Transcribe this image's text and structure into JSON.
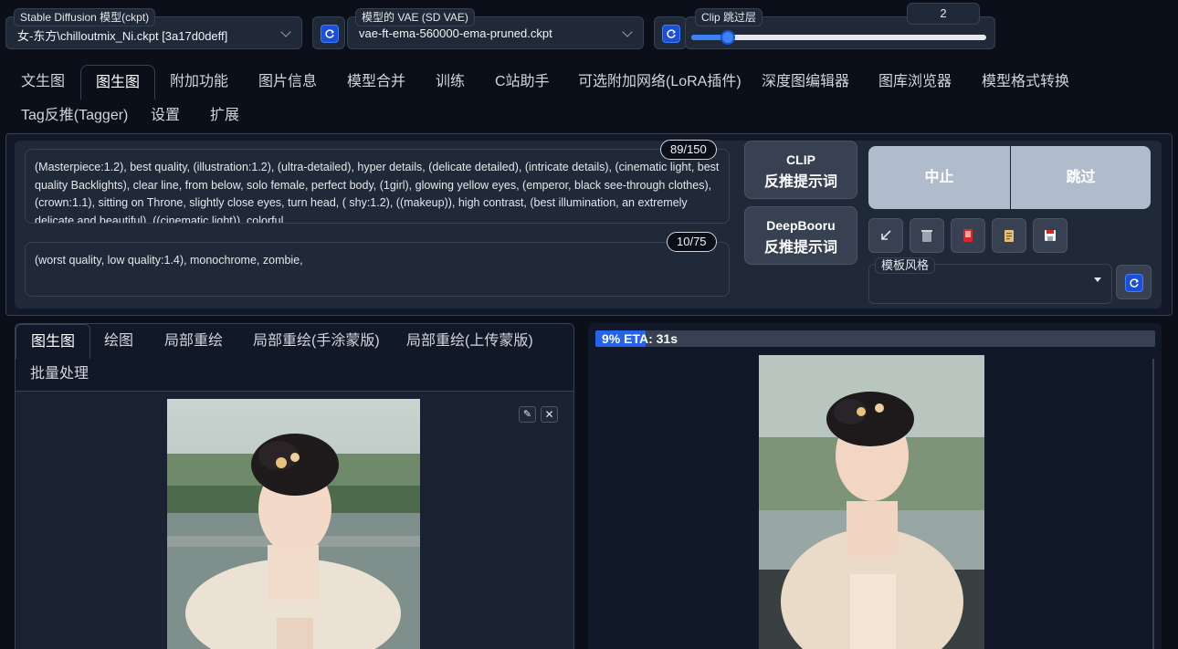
{
  "top": {
    "model": {
      "label": "Stable Diffusion 模型(ckpt)",
      "value": "女-东方\\chilloutmix_Ni.ckpt [3a17d0deff]"
    },
    "vae": {
      "label": "模型的 VAE (SD VAE)",
      "value": "vae-ft-ema-560000-ema-pruned.ckpt"
    },
    "clip": {
      "label": "Clip 跳过层",
      "value": "2",
      "slider_fraction": 0.03
    }
  },
  "tabs": [
    "文生图",
    "图生图",
    "附加功能",
    "图片信息",
    "模型合并",
    "训练",
    "C站助手",
    "可选附加网络(LoRA插件)",
    "深度图编辑器",
    "图库浏览器",
    "模型格式转换",
    "Tag反推(Tagger)",
    "设置",
    "扩展"
  ],
  "active_tab": "图生图",
  "prompt": {
    "positive": "(Masterpiece:1.2), best quality, (illustration:1.2), (ultra-detailed), hyper details, (delicate detailed), (intricate details), (cinematic light, best quality Backlights), clear line, from below, solo female, perfect body, (1girl), glowing yellow eyes, (emperor, black see-through clothes),(crown:1.1), sitting on Throne, slightly close eyes, turn head, ( shy:1.2), ((makeup)), high contrast, (best illumination, an extremely delicate and beautiful), ((cinematic light)), colorful",
    "positive_count": "89/150",
    "negative": "(worst quality, low quality:1.4), monochrome, zombie,",
    "negative_count": "10/75"
  },
  "buttons": {
    "clip_title": "CLIP",
    "clip_sub": "反推提示词",
    "deepbooru_title": "DeepBooru",
    "deepbooru_sub": "反推提示词",
    "interrupt": "中止",
    "skip": "跳过"
  },
  "tool_icons": [
    "arrow-icon",
    "trash-icon",
    "red-card-icon",
    "clipboard-icon",
    "save-icon"
  ],
  "style": {
    "label": "模板风格",
    "value": ""
  },
  "subtabs": [
    "图生图",
    "绘图",
    "局部重绘",
    "局部重绘(手涂蒙版)",
    "局部重绘(上传蒙版)",
    "批量处理"
  ],
  "active_subtab": "图生图",
  "progress": {
    "text": "9% ETA: 31s",
    "fraction": 0.09
  },
  "colors": {
    "accent": "#1d4ed8",
    "background": "#0b0f19",
    "panel": "#1f2937"
  }
}
